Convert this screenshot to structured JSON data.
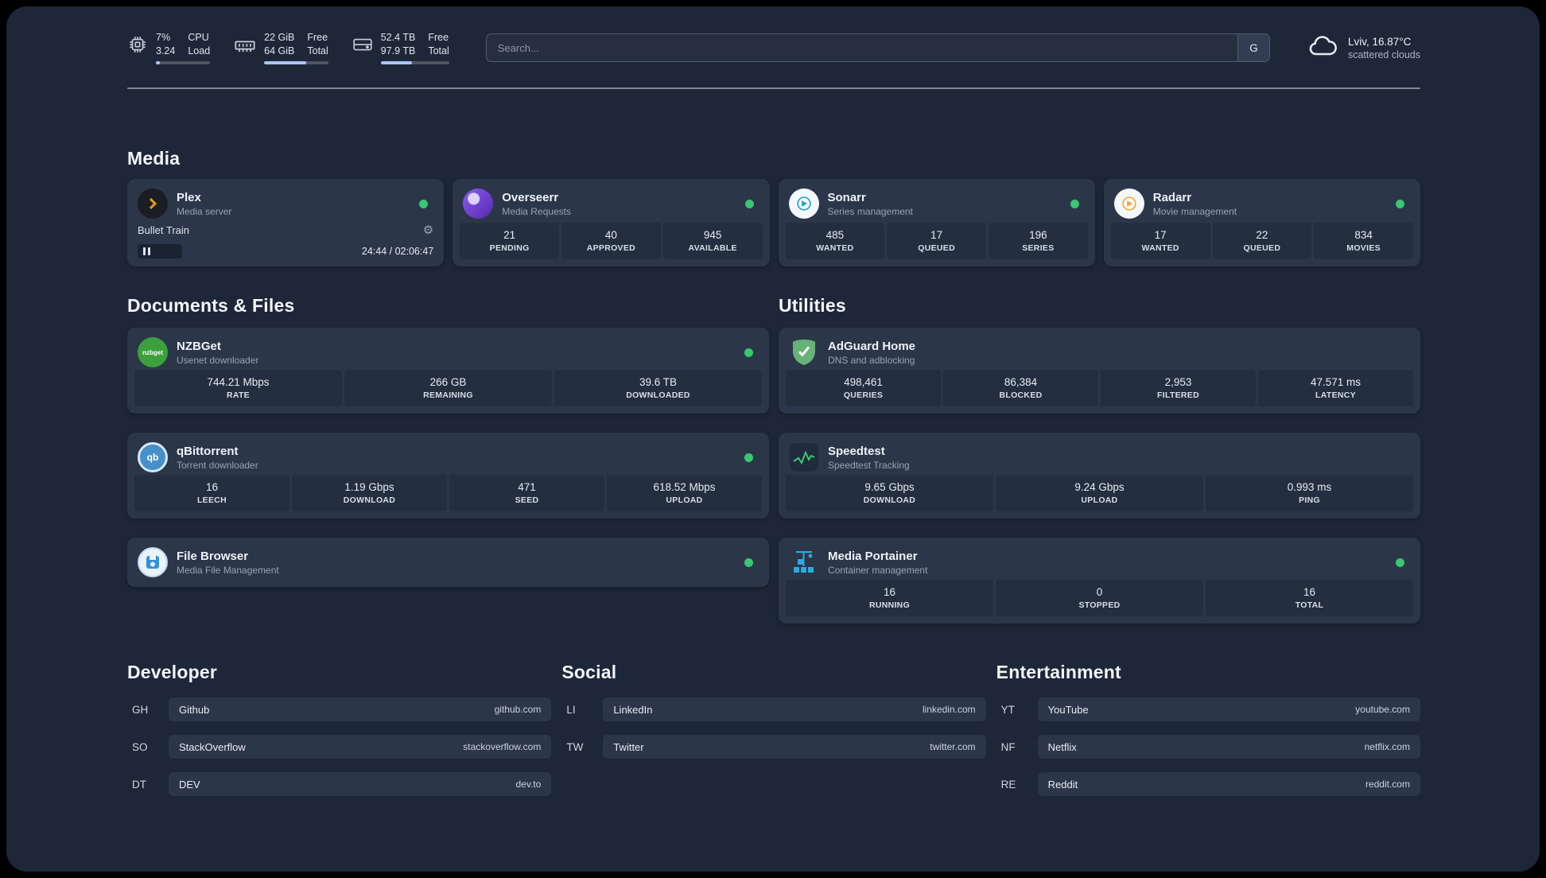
{
  "topbar": {
    "cpu": {
      "icon": "cpu-icon",
      "percent": "7%",
      "load": "3.24",
      "label_top": "CPU",
      "label_bottom": "Load",
      "bar_percent": 7
    },
    "ram": {
      "icon": "ram-icon",
      "free_value": "22 GiB",
      "free_label": "Free",
      "total_value": "64 GiB",
      "total_label": "Total",
      "bar_percent": 66
    },
    "disk": {
      "icon": "disk-icon",
      "free_value": "52.4 TB",
      "free_label": "Free",
      "total_value": "97.9 TB",
      "total_label": "Total",
      "bar_percent": 46
    },
    "search": {
      "placeholder": "Search...",
      "button_label": "G"
    },
    "weather": {
      "icon": "cloud-icon",
      "location": "Lviv, 16.87°C",
      "condition": "scattered clouds"
    }
  },
  "sections": {
    "media": {
      "title": "Media",
      "cards": [
        {
          "name": "Plex",
          "subtitle": "Media server",
          "icon": "plex-icon",
          "status": "online",
          "player": {
            "track": "Bullet Train",
            "time": "24:44 / 02:06:47",
            "state": "paused"
          }
        },
        {
          "name": "Overseerr",
          "subtitle": "Media Requests",
          "icon": "overseerr-icon",
          "status": "online",
          "stats": [
            {
              "value": "21",
              "label": "PENDING"
            },
            {
              "value": "40",
              "label": "APPROVED"
            },
            {
              "value": "945",
              "label": "AVAILABLE"
            }
          ]
        },
        {
          "name": "Sonarr",
          "subtitle": "Series management",
          "icon": "sonarr-icon",
          "status": "online",
          "stats": [
            {
              "value": "485",
              "label": "WANTED"
            },
            {
              "value": "17",
              "label": "QUEUED"
            },
            {
              "value": "196",
              "label": "SERIES"
            }
          ]
        },
        {
          "name": "Radarr",
          "subtitle": "Movie management",
          "icon": "radarr-icon",
          "status": "online",
          "stats": [
            {
              "value": "17",
              "label": "WANTED"
            },
            {
              "value": "22",
              "label": "QUEUED"
            },
            {
              "value": "834",
              "label": "MOVIES"
            }
          ]
        }
      ]
    },
    "documents": {
      "title": "Documents & Files",
      "cards": [
        {
          "name": "NZBGet",
          "subtitle": "Usenet downloader",
          "icon": "nzbget-icon",
          "status": "online",
          "stats": [
            {
              "value": "744.21 Mbps",
              "label": "RATE"
            },
            {
              "value": "266 GB",
              "label": "REMAINING"
            },
            {
              "value": "39.6 TB",
              "label": "DOWNLOADED"
            }
          ]
        },
        {
          "name": "qBittorrent",
          "subtitle": "Torrent downloader",
          "icon": "qbittorrent-icon",
          "status": "online",
          "stats": [
            {
              "value": "16",
              "label": "LEECH"
            },
            {
              "value": "1.19 Gbps",
              "label": "DOWNLOAD"
            },
            {
              "value": "471",
              "label": "SEED"
            },
            {
              "value": "618.52 Mbps",
              "label": "UPLOAD"
            }
          ]
        },
        {
          "name": "File Browser",
          "subtitle": "Media File Management",
          "icon": "filebrowser-icon",
          "status": "online",
          "stats": []
        }
      ]
    },
    "utilities": {
      "title": "Utilities",
      "cards": [
        {
          "name": "AdGuard Home",
          "subtitle": "DNS and adblocking",
          "icon": "adguard-icon",
          "stats": [
            {
              "value": "498,461",
              "label": "QUERIES"
            },
            {
              "value": "86,384",
              "label": "BLOCKED"
            },
            {
              "value": "2,953",
              "label": "FILTERED"
            },
            {
              "value": "47.571 ms",
              "label": "LATENCY"
            }
          ]
        },
        {
          "name": "Speedtest",
          "subtitle": "Speedtest Tracking",
          "icon": "speedtest-icon",
          "stats": [
            {
              "value": "9.65 Gbps",
              "label": "DOWNLOAD"
            },
            {
              "value": "9.24 Gbps",
              "label": "UPLOAD"
            },
            {
              "value": "0.993 ms",
              "label": "PING"
            }
          ]
        },
        {
          "name": "Media Portainer",
          "subtitle": "Container management",
          "icon": "portainer-icon",
          "status": "online",
          "stats": [
            {
              "value": "16",
              "label": "RUNNING"
            },
            {
              "value": "0",
              "label": "STOPPED"
            },
            {
              "value": "16",
              "label": "TOTAL"
            }
          ]
        }
      ]
    },
    "bookmarks": [
      {
        "title": "Developer",
        "links": [
          {
            "abbr": "GH",
            "name": "Github",
            "url": "github.com"
          },
          {
            "abbr": "SO",
            "name": "StackOverflow",
            "url": "stackoverflow.com"
          },
          {
            "abbr": "DT",
            "name": "DEV",
            "url": "dev.to"
          }
        ]
      },
      {
        "title": "Social",
        "links": [
          {
            "abbr": "LI",
            "name": "LinkedIn",
            "url": "linkedin.com"
          },
          {
            "abbr": "TW",
            "name": "Twitter",
            "url": "twitter.com"
          }
        ]
      },
      {
        "title": "Entertainment",
        "links": [
          {
            "abbr": "YT",
            "name": "YouTube",
            "url": "youtube.com"
          },
          {
            "abbr": "NF",
            "name": "Netflix",
            "url": "netflix.com"
          },
          {
            "abbr": "RE",
            "name": "Reddit",
            "url": "reddit.com"
          }
        ]
      }
    ]
  },
  "icon_labels": {
    "nzbget": "nzbget",
    "qbittorrent": "qb"
  },
  "colors": {
    "status_online": "#37c871",
    "panel_bg": "#1d2737",
    "card_bg": "#2c3649",
    "stat_bg": "#232e3f",
    "plex_accent": "#e5a00d",
    "overseerr_accent": "#8b5cf6",
    "sonarr_accent": "#1f9fd6",
    "radarr_accent": "#f9a825",
    "adguard_accent": "#67b279",
    "portainer_accent": "#2daae2"
  }
}
